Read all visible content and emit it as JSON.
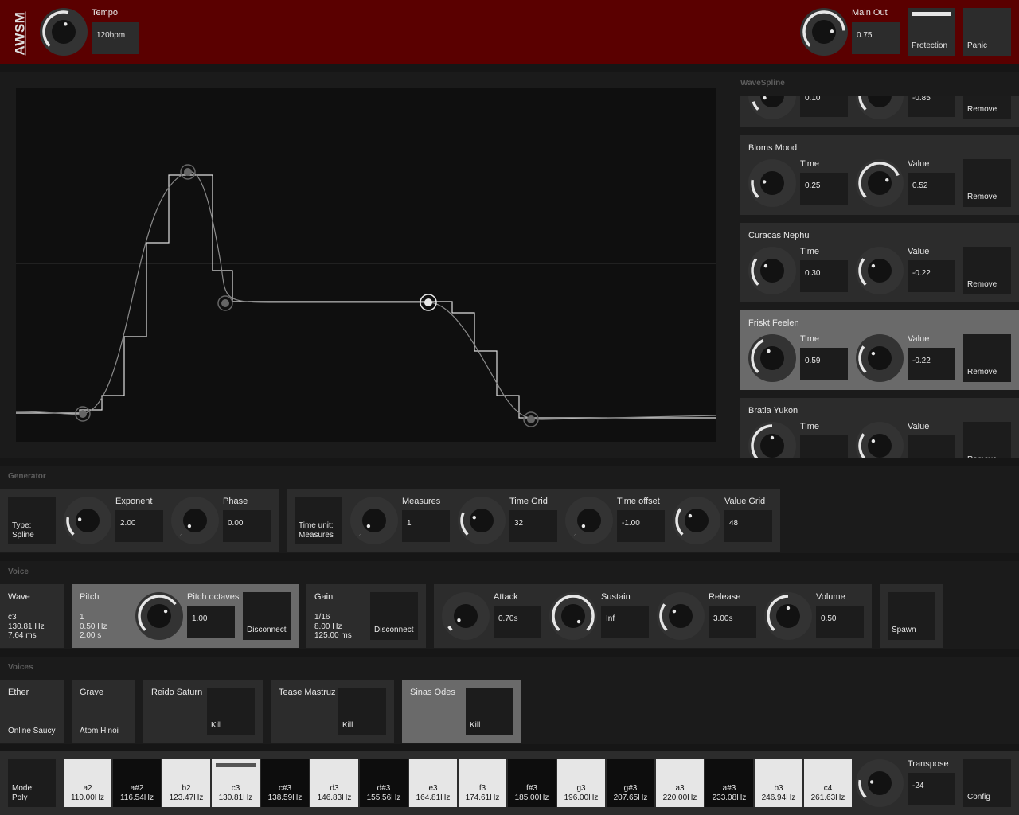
{
  "header": {
    "logo": "AWSM",
    "tempo_label": "Tempo",
    "tempo_value": "120bpm",
    "main_out_label": "Main Out",
    "main_out_value": "0.75",
    "protection_label": "Protection",
    "panic_label": "Panic",
    "bg_color": "#5a0000"
  },
  "wavespline": {
    "title": "WaveSpline",
    "remove_label": "Remove",
    "time_label": "Time",
    "value_label": "Value",
    "points": [
      {
        "name": "",
        "time": "0.10",
        "value": "-0.85"
      },
      {
        "name": "Bloms Mood",
        "time": "0.25",
        "value": "0.52"
      },
      {
        "name": "Curacas Nephu",
        "time": "0.30",
        "value": "-0.22"
      },
      {
        "name": "Friskt Feelen",
        "time": "0.59",
        "value": "-0.22",
        "selected": true
      },
      {
        "name": "Bratia Yukon",
        "time": "",
        "value": ""
      }
    ]
  },
  "generator": {
    "title": "Generator",
    "type_label": "Type:",
    "type_value": "Spline",
    "exponent_label": "Exponent",
    "exponent_value": "2.00",
    "phase_label": "Phase",
    "phase_value": "0.00",
    "time_unit_label": "Time unit:",
    "time_unit_value": "Measures",
    "measures_label": "Measures",
    "measures_value": "1",
    "time_grid_label": "Time Grid",
    "time_grid_value": "32",
    "time_offset_label": "Time offset",
    "time_offset_value": "-1.00",
    "value_grid_label": "Value Grid",
    "value_grid_value": "48"
  },
  "voice": {
    "title": "Voice",
    "wave_label": "Wave",
    "wave_note": "c3",
    "wave_freq": "130.81 Hz",
    "wave_ms": "7.64 ms",
    "pitch_label": "Pitch",
    "pitch_l1": "1",
    "pitch_l2": "0.50 Hz",
    "pitch_l3": "2.00 s",
    "pitch_octaves_label": "Pitch octaves",
    "pitch_octaves_value": "1.00",
    "disconnect_label": "Disconnect",
    "gain_label": "Gain",
    "gain_l1": "1/16",
    "gain_l2": "8.00 Hz",
    "gain_l3": "125.00 ms",
    "attack_label": "Attack",
    "attack_value": "0.70s",
    "sustain_label": "Sustain",
    "sustain_value": "Inf",
    "release_label": "Release",
    "release_value": "3.00s",
    "volume_label": "Volume",
    "volume_value": "0.50",
    "spawn_label": "Spawn"
  },
  "voices": {
    "title": "Voices",
    "kill_label": "Kill",
    "items": [
      {
        "name": "Ether",
        "sub": "Online Saucy"
      },
      {
        "name": "Grave",
        "sub": "Atom Hinoi"
      },
      {
        "name": "Reido Saturn"
      },
      {
        "name": "Tease Mastruz"
      },
      {
        "name": "Sinas Odes"
      }
    ]
  },
  "keyboard": {
    "mode_label": "Mode:",
    "mode_value": "Poly",
    "transpose_label": "Transpose",
    "transpose_value": "-24",
    "config_label": "Config",
    "keys": [
      {
        "note": "a2",
        "freq": "110.00Hz",
        "black": false
      },
      {
        "note": "a#2",
        "freq": "116.54Hz",
        "black": true
      },
      {
        "note": "b2",
        "freq": "123.47Hz",
        "black": false
      },
      {
        "note": "c3",
        "freq": "130.81Hz",
        "black": false,
        "active": true
      },
      {
        "note": "c#3",
        "freq": "138.59Hz",
        "black": true
      },
      {
        "note": "d3",
        "freq": "146.83Hz",
        "black": false
      },
      {
        "note": "d#3",
        "freq": "155.56Hz",
        "black": true
      },
      {
        "note": "e3",
        "freq": "164.81Hz",
        "black": false
      },
      {
        "note": "f3",
        "freq": "174.61Hz",
        "black": false
      },
      {
        "note": "f#3",
        "freq": "185.00Hz",
        "black": true
      },
      {
        "note": "g3",
        "freq": "196.00Hz",
        "black": false
      },
      {
        "note": "g#3",
        "freq": "207.65Hz",
        "black": true
      },
      {
        "note": "a3",
        "freq": "220.00Hz",
        "black": false
      },
      {
        "note": "a#3",
        "freq": "233.08Hz",
        "black": true
      },
      {
        "note": "b3",
        "freq": "246.94Hz",
        "black": false
      },
      {
        "note": "c4",
        "freq": "261.63Hz",
        "black": false
      }
    ]
  }
}
